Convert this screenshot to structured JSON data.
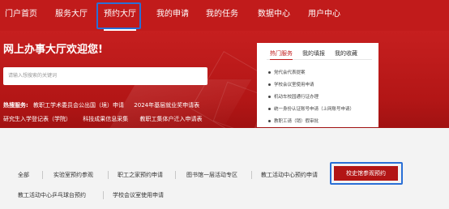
{
  "nav": {
    "items": [
      "门户首页",
      "服务大厅",
      "预约大厅",
      "我的申请",
      "我的任务",
      "数据中心",
      "用户中心"
    ],
    "active": "预约大厅"
  },
  "banner": {
    "welcome": "网上办事大厅欢迎您!",
    "search_placeholder": "请输入想搜索的关键词",
    "hot_label": "热搜服务:",
    "hot_links": [
      "教职工学术委员会公出国（境）申请",
      "2024年基层就业奖申请表",
      "研究生入学登记表（学院）",
      "科技成果信息采集",
      "教职工集体户迁入申请表"
    ]
  },
  "panel": {
    "tabs": [
      "热门服务",
      "我的填报",
      "我的收藏"
    ],
    "items": [
      "党代会代表提案",
      "学校会议室使用申请",
      "机动车校园通行证办理",
      "统一身份认证账号申请（上网账号申请）",
      "教职工请（销）假审批"
    ]
  },
  "appointments": {
    "row1": [
      "全部",
      "实验室预约参观",
      "职工之家预约申请",
      "图书馆一层活动专区",
      "教工活动中心预约申请",
      "校史馆参观预约"
    ],
    "row2": [
      "教工活动中心乒乓球台预约",
      "学校会议室使用申请"
    ],
    "active": "校史馆参观预约"
  },
  "colors": {
    "brand_red": "#c11b1b",
    "highlight_blue": "#2a6fd6",
    "bg_gray": "#f3f3f3"
  }
}
